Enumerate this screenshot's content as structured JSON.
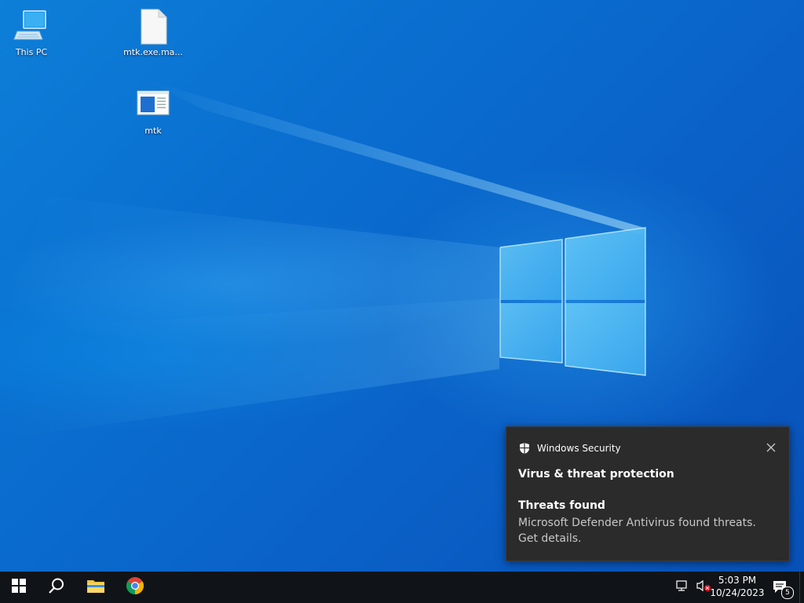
{
  "desktop": {
    "icons": [
      {
        "label": "This PC",
        "icon": "this-pc-icon"
      },
      {
        "label": "mtk.exe.ma...",
        "icon": "blank-file-icon"
      },
      {
        "label": "mtk",
        "icon": "application-window-icon"
      }
    ]
  },
  "toast": {
    "app_name": "Windows Security",
    "title": "Virus & threat protection",
    "subtitle": "Threats found",
    "body": "Microsoft Defender Antivirus found threats. Get details.",
    "icons": {
      "app": "shield-icon",
      "close": "close-icon"
    }
  },
  "taskbar": {
    "items": [
      {
        "name": "start",
        "icon": "windows-logo-icon"
      },
      {
        "name": "search",
        "icon": "search-icon"
      },
      {
        "name": "file-explorer",
        "icon": "folder-icon"
      },
      {
        "name": "chrome",
        "icon": "chrome-icon"
      }
    ],
    "tray": {
      "network_icon": "network-icon",
      "volume_icon": "volume-muted-icon",
      "time": "5:03 PM",
      "date": "10/24/2023",
      "notification_count": "5",
      "notification_icon": "action-center-icon"
    }
  },
  "colors": {
    "taskbar_bg": "#101418",
    "toast_bg": "#2b2b2b",
    "desktop_blue": "#0a6fd0",
    "toast_body_text": "#c8c8c8"
  }
}
